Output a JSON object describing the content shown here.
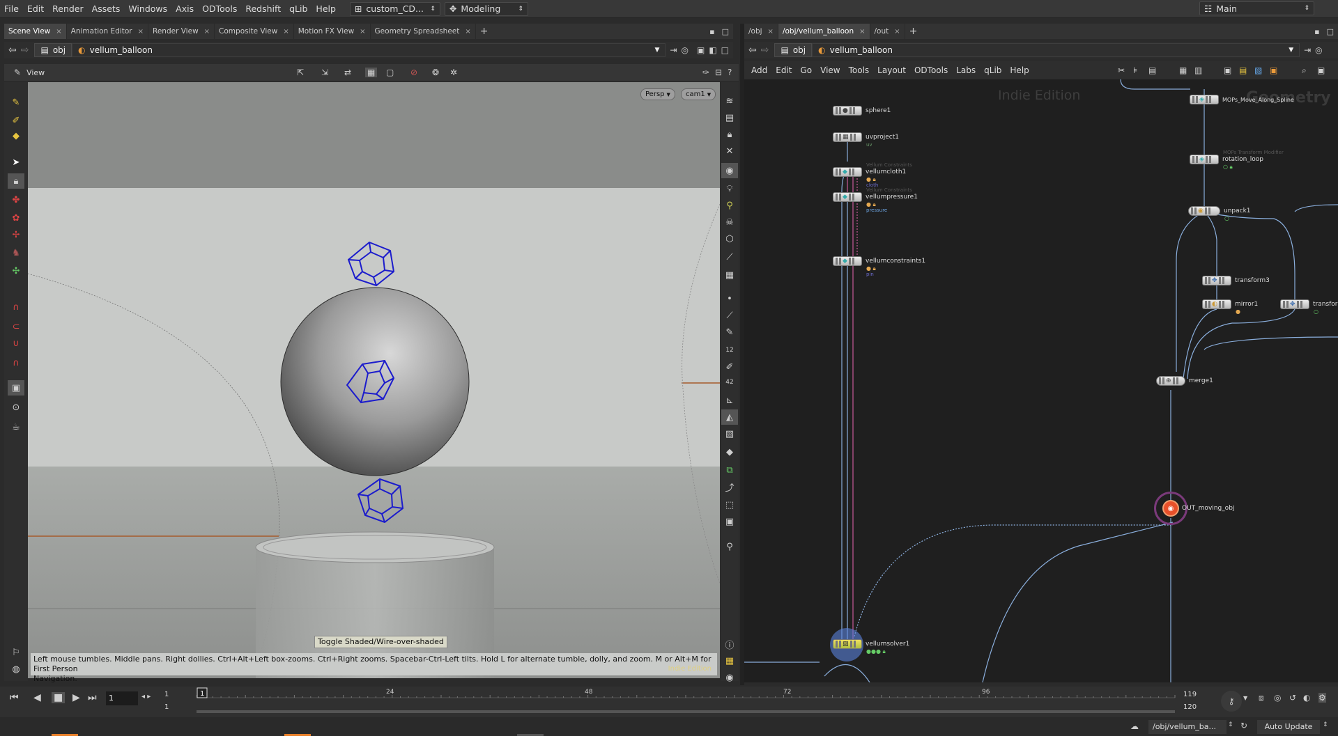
{
  "menubar": {
    "items": [
      "File",
      "Edit",
      "Render",
      "Assets",
      "Windows",
      "Axis",
      "ODTools",
      "Redshift",
      "qLib",
      "Help"
    ],
    "desktop": "custom_CD...",
    "shelf": "Modeling",
    "main": "Main"
  },
  "left_pane": {
    "tabs": [
      "Scene View",
      "Animation Editor",
      "Render View",
      "Composite View",
      "Motion FX View",
      "Geometry Spreadsheet"
    ],
    "path_root": "obj",
    "path_node": "vellum_balloon",
    "view_label": "View",
    "camera_mode": "Persp",
    "camera": "cam1",
    "tooltip": "Toggle Shaded/Wire-over-shaded",
    "status_line1": "Left mouse tumbles. Middle pans. Right dollies. Ctrl+Alt+Left box-zooms. Ctrl+Right zooms. Spacebar-Ctrl-Left tilts. Hold L for alternate tumble, dolly, and zoom.     M or Alt+M for First Person",
    "status_line2": "Navigation.",
    "watermark": "Indie Edition"
  },
  "right_pane": {
    "tabs": [
      "/obj",
      "/obj/vellum_balloon",
      "/out"
    ],
    "path_root": "obj",
    "path_node": "vellum_balloon",
    "menu": [
      "Add",
      "Edit",
      "Go",
      "View",
      "Tools",
      "Layout",
      "ODTools",
      "Labs",
      "qLib",
      "Help"
    ],
    "watermark": "Indie Edition",
    "context_label": "Geometry"
  },
  "nodes": {
    "sphere1": {
      "name": "sphere1"
    },
    "uvproject1": {
      "name": "uvproject1",
      "sub": "uv"
    },
    "vellumcloth1": {
      "name": "vellumcloth1",
      "type": "Vellum Constraints",
      "sub": "cloth"
    },
    "vellumpressure1": {
      "name": "vellumpressure1",
      "type": "Vellum Constraints",
      "sub": "pressure"
    },
    "vellumconstraints1": {
      "name": "vellumconstraints1",
      "sub": "pin"
    },
    "vellumsolver1": {
      "name": "vellumsolver1"
    },
    "mops_move": {
      "name": "MOPs_Move_Along_Spline"
    },
    "rotation_loop": {
      "name": "rotation_loop",
      "type": "MOPs Transform Modifier"
    },
    "unpack1": {
      "name": "unpack1"
    },
    "transform3": {
      "name": "transform3"
    },
    "mirror1": {
      "name": "mirror1"
    },
    "transform_partial": {
      "name": "transform"
    },
    "merge1": {
      "name": "merge1"
    },
    "out": {
      "name": "OUT_moving_obj"
    }
  },
  "timeline": {
    "current_frame": "1",
    "start_frame": "1",
    "start_frame2": "1",
    "end_frame": "119",
    "end_frame2": "120",
    "ticks": [
      "24",
      "48",
      "72",
      "96"
    ],
    "marker": "1",
    "playhead_fraction": 0.0,
    "range_fraction": 1.0
  },
  "statusbar": {
    "path": "/obj/vellum_ba...",
    "update_mode": "Auto Update"
  },
  "colors": {
    "wire_blue": "#1c1ccc",
    "out_node": "#e8502a",
    "solver": "#5a9ad6",
    "pink_wire": "#c85a9a"
  }
}
